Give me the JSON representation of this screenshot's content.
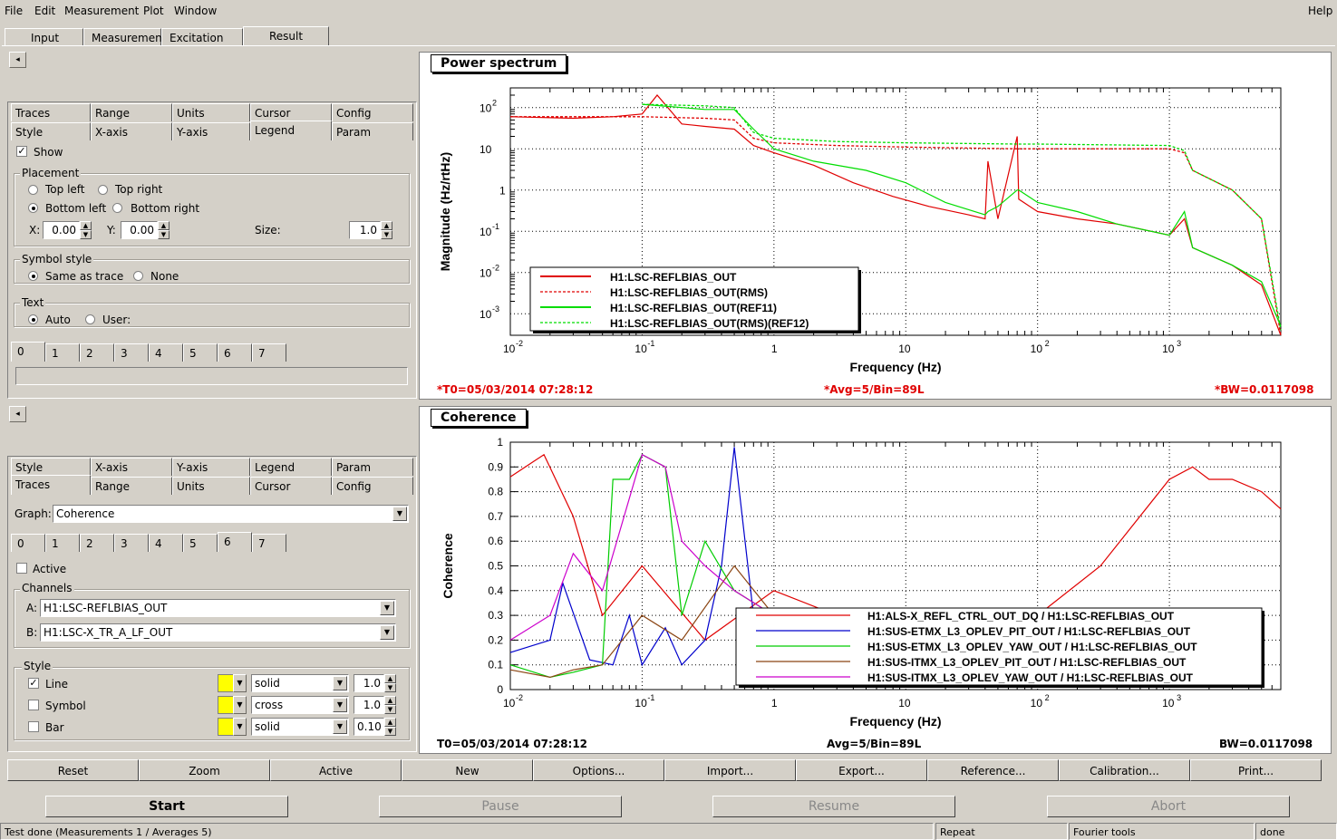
{
  "menu": {
    "file": "File",
    "edit": "Edit",
    "measurement": "Measurement",
    "plot": "Plot",
    "window": "Window",
    "help": "Help"
  },
  "main_tabs": [
    "Input",
    "Measurement",
    "Excitation",
    "Result"
  ],
  "top_options": {
    "tabs_row1": [
      "Traces",
      "Range",
      "Units",
      "Cursor",
      "Config"
    ],
    "tabs_row2": [
      "Style",
      "X-axis",
      "Y-axis",
      "Legend",
      "Param"
    ],
    "show": "Show",
    "placement": "Placement",
    "top_left": "Top left",
    "top_right": "Top right",
    "bottom_left": "Bottom left",
    "bottom_right": "Bottom right",
    "x_label": "X:",
    "x_val": "0.00",
    "y_label": "Y:",
    "y_val": "0.00",
    "size_label": "Size:",
    "size_val": "1.0",
    "symbol_style": "Symbol style",
    "same_as_trace": "Same as trace",
    "none": "None",
    "text": "Text",
    "auto": "Auto",
    "user": "User:",
    "trace_tabs": [
      "0",
      "1",
      "2",
      "3",
      "4",
      "5",
      "6",
      "7"
    ]
  },
  "bottom_options": {
    "tabs_row1": [
      "Style",
      "X-axis",
      "Y-axis",
      "Legend",
      "Param"
    ],
    "tabs_row2": [
      "Traces",
      "Range",
      "Units",
      "Cursor",
      "Config"
    ],
    "graph_label": "Graph:",
    "graph_val": "Coherence",
    "trace_tabs": [
      "0",
      "1",
      "2",
      "3",
      "4",
      "5",
      "6",
      "7"
    ],
    "active": "Active",
    "channels": "Channels",
    "a_label": "A:",
    "a_val": "H1:LSC-REFLBIAS_OUT",
    "b_label": "B:",
    "b_val": "H1:LSC-X_TR_A_LF_OUT",
    "style": "Style",
    "line": "Line",
    "line_style": "solid",
    "line_w": "1.0",
    "symbol": "Symbol",
    "symbol_style": "cross",
    "symbol_w": "1.0",
    "bar": "Bar",
    "bar_style": "solid",
    "bar_w": "0.10",
    "color": "#ffff00"
  },
  "power_panel": {
    "title": "Power spectrum",
    "xlabel": "Frequency (Hz)",
    "ylabel": "Magnitude (Hz/rtHz)",
    "t0": "*T0=05/03/2014 07:28:12",
    "avg": "*Avg=5/Bin=89L",
    "bw": "*BW=0.0117098",
    "legend": [
      {
        "name": "H1:LSC-REFLBIAS_OUT",
        "color": "#e00000",
        "dash": ""
      },
      {
        "name": "H1:LSC-REFLBIAS_OUT(RMS)",
        "color": "#e00000",
        "dash": "3,2"
      },
      {
        "name": "H1:LSC-REFLBIAS_OUT(REF11)",
        "color": "#00dd00",
        "dash": ""
      },
      {
        "name": "H1:LSC-REFLBIAS_OUT(RMS)(REF12)",
        "color": "#00dd00",
        "dash": "3,2"
      }
    ],
    "xticks": [
      "10",
      "10",
      "1",
      "10",
      "10",
      "10"
    ],
    "xtick_exp": [
      "-2",
      "-1",
      "",
      "",
      "2",
      "3"
    ],
    "yticks": [
      "10",
      "10",
      "1",
      "10",
      "10",
      "10"
    ],
    "ytick_exp": [
      "2",
      "",
      "",
      "-1",
      "-2",
      "-3"
    ]
  },
  "coh_panel": {
    "title": "Coherence",
    "xlabel": "Frequency (Hz)",
    "ylabel": "Coherence",
    "t0": "T0=05/03/2014 07:28:12",
    "avg": "Avg=5/Bin=89L",
    "bw": "BW=0.0117098",
    "legend": [
      {
        "name": "H1:ALS-X_REFL_CTRL_OUT_DQ / H1:LSC-REFLBIAS_OUT",
        "color": "#e00000"
      },
      {
        "name": "H1:SUS-ETMX_L3_OPLEV_PIT_OUT / H1:LSC-REFLBIAS_OUT",
        "color": "#0000cc"
      },
      {
        "name": "H1:SUS-ETMX_L3_OPLEV_YAW_OUT / H1:LSC-REFLBIAS_OUT",
        "color": "#00cc00"
      },
      {
        "name": "H1:SUS-ITMX_L3_OPLEV_PIT_OUT / H1:LSC-REFLBIAS_OUT",
        "color": "#8b4513"
      },
      {
        "name": "H1:SUS-ITMX_L3_OPLEV_YAW_OUT / H1:LSC-REFLBIAS_OUT",
        "color": "#cc00cc"
      }
    ],
    "yticks": [
      "0",
      "0.1",
      "0.2",
      "0.3",
      "0.4",
      "0.5",
      "0.6",
      "0.7",
      "0.8",
      "0.9",
      "1"
    ]
  },
  "chart_data": [
    {
      "type": "line",
      "title": "Power spectrum",
      "xlabel": "Frequency (Hz)",
      "ylabel": "Magnitude (Hz/rtHz)",
      "xscale": "log",
      "yscale": "log",
      "xlim": [
        0.01,
        7000
      ],
      "ylim": [
        0.0003,
        300
      ],
      "grid": true,
      "legend_position": "bottom-left",
      "series": [
        {
          "name": "H1:LSC-REFLBIAS_OUT",
          "color": "#e00000",
          "style": "solid",
          "x": [
            0.01,
            0.03,
            0.06,
            0.1,
            0.13,
            0.2,
            0.3,
            0.5,
            0.7,
            1,
            2,
            4,
            8,
            15,
            30,
            40,
            42,
            50,
            70,
            72,
            100,
            200,
            400,
            1000,
            1300,
            1500,
            3000,
            5000,
            7000
          ],
          "y": [
            60,
            55,
            60,
            70,
            200,
            40,
            35,
            30,
            12,
            8,
            4,
            1.5,
            0.7,
            0.4,
            0.25,
            0.2,
            5,
            0.2,
            20,
            0.6,
            0.3,
            0.2,
            0.15,
            0.08,
            0.2,
            0.04,
            0.015,
            0.005,
            0.0003
          ]
        },
        {
          "name": "H1:LSC-REFLBIAS_OUT(RMS)",
          "color": "#e00000",
          "style": "dashed",
          "x": [
            0.01,
            0.1,
            0.3,
            0.5,
            0.7,
            1,
            3,
            10,
            70,
            100,
            1000,
            1300,
            1500,
            3000,
            5000,
            7000
          ],
          "y": [
            60,
            60,
            55,
            50,
            18,
            14,
            12,
            11,
            10,
            10,
            10,
            8,
            3,
            1,
            0.2,
            0.0003
          ]
        },
        {
          "name": "H1:LSC-REFLBIAS_OUT(REF11)",
          "color": "#00dd00",
          "style": "solid",
          "x": [
            0.1,
            0.3,
            0.5,
            0.7,
            1,
            2,
            5,
            10,
            20,
            40,
            42,
            50,
            70,
            72,
            100,
            200,
            400,
            1000,
            1300,
            1500,
            3000,
            5000,
            7000
          ],
          "y": [
            120,
            90,
            90,
            30,
            10,
            5,
            3,
            1.5,
            0.5,
            0.25,
            0.3,
            0.4,
            1,
            1,
            0.5,
            0.3,
            0.15,
            0.08,
            0.3,
            0.04,
            0.015,
            0.006,
            0.0005
          ]
        },
        {
          "name": "H1:LSC-REFLBIAS_OUT(RMS)(REF12)",
          "color": "#00dd00",
          "style": "dashed",
          "x": [
            0.1,
            0.3,
            0.5,
            0.7,
            1,
            3,
            10,
            70,
            100,
            1000,
            1300,
            1500,
            3000,
            5000,
            7000
          ],
          "y": [
            120,
            110,
            100,
            25,
            18,
            15,
            14,
            13,
            13,
            12,
            9,
            3,
            1,
            0.2,
            0.0004
          ]
        }
      ]
    },
    {
      "type": "line",
      "title": "Coherence",
      "xlabel": "Frequency (Hz)",
      "ylabel": "Coherence",
      "xscale": "log",
      "xlim": [
        0.01,
        7000
      ],
      "ylim": [
        0,
        1
      ],
      "grid": true,
      "legend_position": "bottom-right",
      "series": [
        {
          "name": "H1:ALS-X_REFL_CTRL_OUT_DQ / H1:LSC-REFLBIAS_OUT",
          "color": "#e00000",
          "x": [
            0.01,
            0.018,
            0.03,
            0.05,
            0.1,
            0.3,
            1,
            3,
            10,
            100,
            300,
            1000,
            1500,
            2000,
            3000,
            5000,
            7000
          ],
          "y": [
            0.86,
            0.95,
            0.7,
            0.3,
            0.5,
            0.2,
            0.4,
            0.3,
            0.3,
            0.3,
            0.5,
            0.85,
            0.9,
            0.85,
            0.85,
            0.8,
            0.73
          ]
        },
        {
          "name": "H1:SUS-ETMX_L3_OPLEV_PIT_OUT / H1:LSC-REFLBIAS_OUT",
          "color": "#0000cc",
          "x": [
            0.01,
            0.02,
            0.025,
            0.04,
            0.06,
            0.08,
            0.1,
            0.15,
            0.2,
            0.3,
            0.4,
            0.5,
            0.7,
            1,
            2,
            5,
            10
          ],
          "y": [
            0.15,
            0.2,
            0.43,
            0.12,
            0.1,
            0.3,
            0.1,
            0.25,
            0.1,
            0.2,
            0.5,
            0.98,
            0.3,
            0.2,
            0.3,
            0.2,
            0.1
          ]
        },
        {
          "name": "H1:SUS-ETMX_L3_OPLEV_YAW_OUT / H1:LSC-REFLBIAS_OUT",
          "color": "#00cc00",
          "x": [
            0.01,
            0.02,
            0.03,
            0.05,
            0.06,
            0.08,
            0.1,
            0.15,
            0.2,
            0.3,
            0.5,
            1,
            3,
            10
          ],
          "y": [
            0.1,
            0.05,
            0.07,
            0.1,
            0.85,
            0.85,
            0.95,
            0.9,
            0.3,
            0.6,
            0.4,
            0.3,
            0.2,
            0.1
          ]
        },
        {
          "name": "H1:SUS-ITMX_L3_OPLEV_PIT_OUT / H1:LSC-REFLBIAS_OUT",
          "color": "#8b4513",
          "x": [
            0.01,
            0.02,
            0.03,
            0.05,
            0.1,
            0.2,
            0.5,
            1,
            3,
            10
          ],
          "y": [
            0.08,
            0.05,
            0.08,
            0.1,
            0.3,
            0.2,
            0.5,
            0.3,
            0.2,
            0.1
          ]
        },
        {
          "name": "H1:SUS-ITMX_L3_OPLEV_YAW_OUT / H1:LSC-REFLBIAS_OUT",
          "color": "#cc00cc",
          "x": [
            0.01,
            0.02,
            0.03,
            0.05,
            0.1,
            0.15,
            0.2,
            0.3,
            0.5,
            1,
            3,
            10
          ],
          "y": [
            0.2,
            0.3,
            0.55,
            0.4,
            0.95,
            0.9,
            0.6,
            0.5,
            0.4,
            0.3,
            0.2,
            0.1
          ]
        }
      ]
    }
  ],
  "action_buttons": [
    "Reset",
    "Zoom",
    "Active",
    "New",
    "Options...",
    "Import...",
    "Export...",
    "Reference...",
    "Calibration...",
    "Print..."
  ],
  "run_buttons": [
    "Start",
    "Pause",
    "Resume",
    "Abort"
  ],
  "status": {
    "left": "Test done (Measurements 1 / Averages 5)",
    "repeat": "Repeat",
    "tool": "Fourier tools",
    "state": "done"
  }
}
